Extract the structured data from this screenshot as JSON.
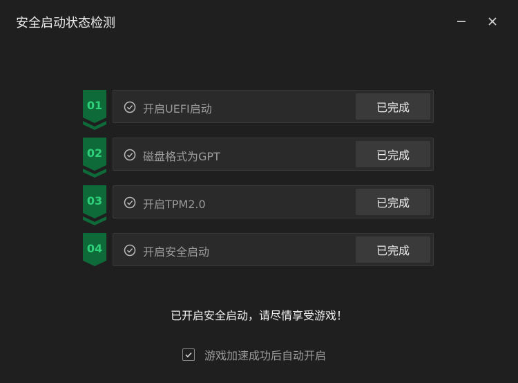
{
  "window": {
    "title": "安全启动状态检测"
  },
  "steps": [
    {
      "num": "01",
      "label": "开启UEFI启动",
      "status": "已完成"
    },
    {
      "num": "02",
      "label": "磁盘格式为GPT",
      "status": "已完成"
    },
    {
      "num": "03",
      "label": "开启TPM2.0",
      "status": "已完成"
    },
    {
      "num": "04",
      "label": "开启安全启动",
      "status": "已完成"
    }
  ],
  "message": "已开启安全启动，请尽情享受游戏！",
  "auto_open": {
    "label": "游戏加速成功后自动开启",
    "checked": true
  },
  "colors": {
    "background": "#1f1f1f",
    "badge": "#0f6a3a",
    "badge_text": "#2fd17a",
    "row": "#2a2a2a",
    "button": "#3a3a3a"
  },
  "icons": {
    "minimize": "minimize-icon",
    "close": "close-icon",
    "step": "check-circle-icon",
    "checkbox": "check-icon"
  }
}
